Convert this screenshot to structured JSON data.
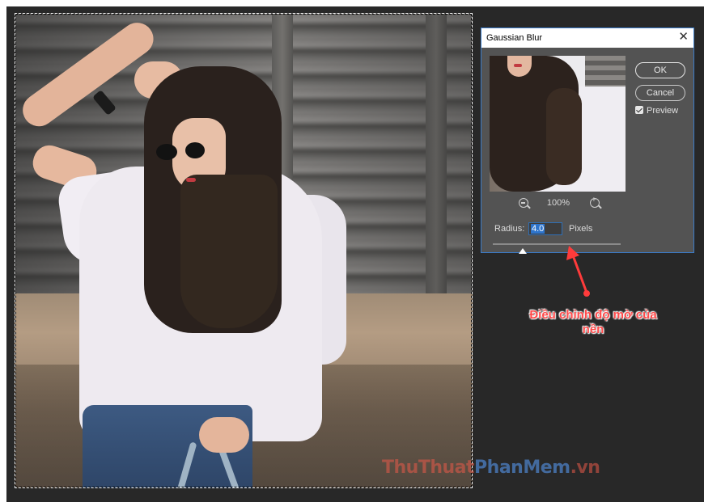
{
  "dialog": {
    "title": "Gaussian Blur",
    "close_icon": "close-icon",
    "ok_label": "OK",
    "cancel_label": "Cancel",
    "preview_label": "Preview",
    "preview_checked": true,
    "zoom_level": "100%",
    "radius_label": "Radius:",
    "radius_value": "4.0",
    "radius_unit": "Pixels"
  },
  "annotation": {
    "text_line1": "Điều chỉnh độ mờ của",
    "text_line2": "nền",
    "color": "#ff4a4a"
  },
  "watermark": {
    "part1": "ThuThuat",
    "part2": "PhanMem",
    "part3": ".vn"
  },
  "colors": {
    "workspace": "#282828",
    "dialog_bg": "#535353",
    "dialog_border": "#3b7bc8",
    "radius_highlight": "#2d74cc"
  }
}
